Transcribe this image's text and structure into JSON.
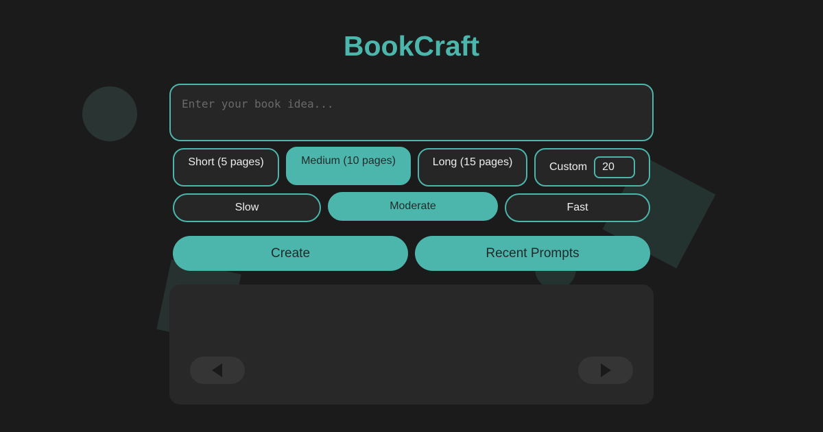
{
  "app": {
    "title": "BookCraft",
    "accent_color": "#4db6ac"
  },
  "idea_input": {
    "placeholder": "Enter your book idea...",
    "value": ""
  },
  "length_options": {
    "short_label": "Short (5 pages)",
    "medium_label": "Medium (10 pages)",
    "long_label": "Long (15 pages)",
    "custom_label": "Custom",
    "custom_value": "20",
    "selected": "Medium (10 pages)"
  },
  "pace_options": {
    "slow_label": "Slow",
    "moderate_label": "Moderate",
    "fast_label": "Fast",
    "selected": "Moderate"
  },
  "actions": {
    "create_label": "Create",
    "recent_label": "Recent Prompts"
  },
  "book_viewer": {
    "prev_icon": "triangle-left-icon",
    "next_icon": "triangle-right-icon"
  }
}
